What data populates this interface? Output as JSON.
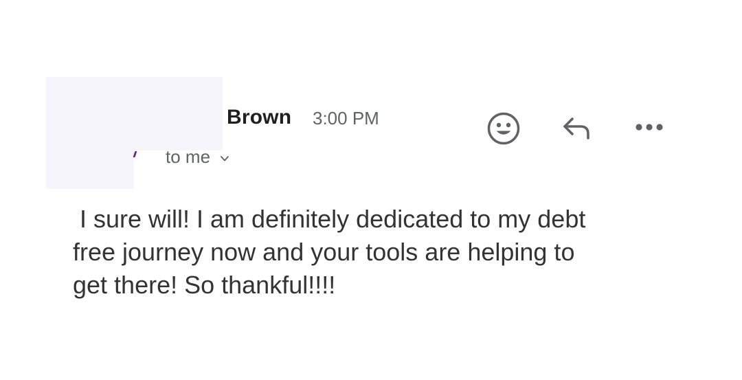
{
  "message": {
    "sender_name": "Brown",
    "time": "3:00 PM",
    "recipient_label": "to me",
    "body_lines": [
      " I sure will! I am definitely dedicated to my debt",
      "free journey now and your tools are helping to",
      "get there! So thankful!!!!"
    ]
  },
  "actions": {
    "emoji_icon": "smiley-face-icon",
    "reply_icon": "reply-arrow-icon",
    "more_icon": "more-horizontal-icon",
    "recipient_icon": "chevron-down-icon"
  },
  "colors": {
    "icon_gray": "#5f6368",
    "text_dark": "#1f1f1f",
    "redaction": "#f5f5fb"
  }
}
